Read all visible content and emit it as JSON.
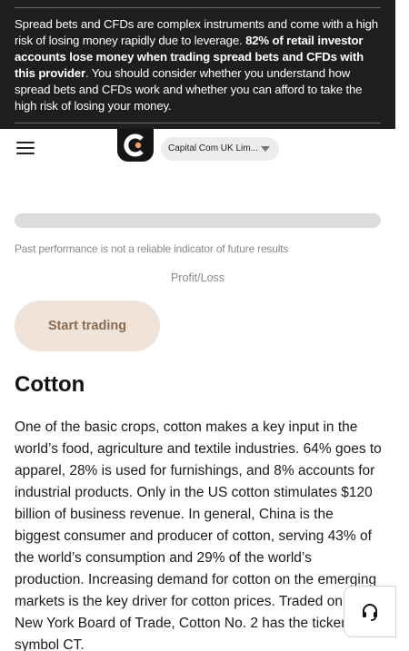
{
  "risk_banner": {
    "text_part1": "Spread bets and CFDs are complex instruments and come with a high risk of losing money rapidly due to leverage.",
    "text_bold": "82% of retail investor accounts lose money when trading spread bets and CFDs with this provider",
    "text_part2": ". You should consider whether you understand how spread bets and CFDs work and whether you can afford to take the high risk of losing your money."
  },
  "header": {
    "menu_icon": "hamburger-menu-icon",
    "logo_icon": "capital-com-logo",
    "entity_selector": "Capital Com UK Lim..."
  },
  "main": {
    "disclaimer": "Past performance is not a reliable indicator of future results",
    "profit_loss_label": "Profit/Loss",
    "start_trading_label": "Start trading",
    "title": "Cotton",
    "description": "One of the basic crops, cotton makes a key input in the world’s food, agriculture and textile industries. 64% goes to apparel, 28% is used for furnishings, and 8% accounts for industrial products. Only in the US cotton stimulates $120 billion of business revenue. In general, China is the biggest consumer and producer of cotton, serving 43% of the world’s consumption and 29% of the world’s production. Increasing demand for cotton on the emerging markets is the key driver for cotton prices. Traded on the New York Board of Trade, Cotton No. 2 has the ticker symbol CT."
  },
  "support": {
    "icon": "headset-icon"
  },
  "colors": {
    "banner_bg": "#1e1e1e",
    "button_bg": "#f0e4da",
    "button_text": "#8a6b52",
    "logo_accent": "#e8a06a"
  }
}
